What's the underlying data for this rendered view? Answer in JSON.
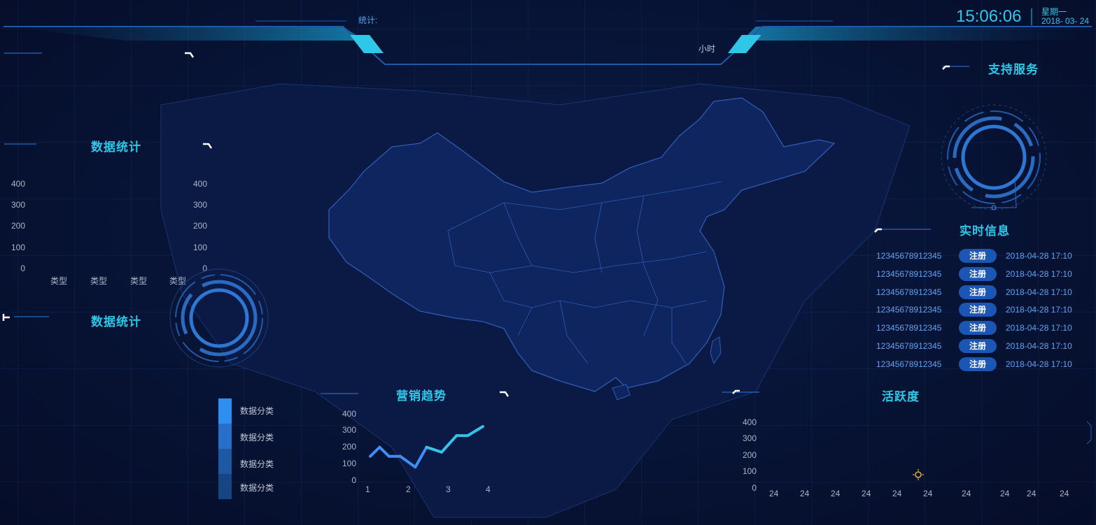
{
  "header": {
    "stat_label": "统计:",
    "hour_label": "小时",
    "time": "15:06:06",
    "weekday": "星期一",
    "date": "2018- 03- 24"
  },
  "left_top_panel": {},
  "data_stats_1": {
    "title": "数据统计",
    "y_ticks_left": [
      "400",
      "300",
      "200",
      "100",
      "0"
    ],
    "y_ticks_right": [
      "400",
      "300",
      "200",
      "100",
      "0"
    ],
    "x_labels": [
      "类型",
      "类型",
      "类型",
      "类型"
    ]
  },
  "data_stats_2": {
    "title": "数据统计",
    "legend": [
      {
        "label": "数据分类",
        "color": "#2e8ff0"
      },
      {
        "label": "数据分类",
        "color": "#2670cc"
      },
      {
        "label": "数据分类",
        "color": "#1d58a3"
      },
      {
        "label": "数据分类",
        "color": "#174584"
      }
    ]
  },
  "marketing": {
    "title": "营销趋势",
    "chart_data": {
      "type": "line",
      "x": [
        1,
        1.25,
        1.5,
        1.8,
        2.2,
        2.5,
        2.9,
        3.3,
        3.6,
        4.0
      ],
      "y_ticks": [
        "400",
        "300",
        "200",
        "100",
        "0"
      ],
      "x_ticks": [
        "1",
        "2",
        "3",
        "4"
      ],
      "ylim": [
        0,
        400
      ],
      "series": [
        {
          "values": [
            140,
            195,
            140,
            140,
            75,
            195,
            165,
            265,
            265,
            320
          ]
        }
      ]
    }
  },
  "activity": {
    "title": "活跃度",
    "y_ticks": [
      "400",
      "300",
      "200",
      "100",
      "0"
    ],
    "x_labels": [
      "24",
      "24",
      "24",
      "24",
      "24",
      "24",
      "24",
      "24",
      "24",
      "24"
    ]
  },
  "support": {
    "title": "支持服务"
  },
  "realtime": {
    "title": "实时信息",
    "rows": [
      {
        "id": "12345678912345",
        "action": "注册",
        "time": "2018-04-28 17:10"
      },
      {
        "id": "12345678912345",
        "action": "注册",
        "time": "2018-04-28 17:10"
      },
      {
        "id": "12345678912345",
        "action": "注册",
        "time": "2018-04-28 17:10"
      },
      {
        "id": "12345678912345",
        "action": "注册",
        "time": "2018-04-28 17:10"
      },
      {
        "id": "12345678912345",
        "action": "注册",
        "time": "2018-04-28 17:10"
      },
      {
        "id": "12345678912345",
        "action": "注册",
        "time": "2018-04-28 17:10"
      },
      {
        "id": "12345678912345",
        "action": "注册",
        "time": "2018-04-28 17:10"
      }
    ]
  },
  "colors": {
    "accent": "#2fc7e8",
    "button": "#1b56b4",
    "frame": "#1f5aa8"
  }
}
